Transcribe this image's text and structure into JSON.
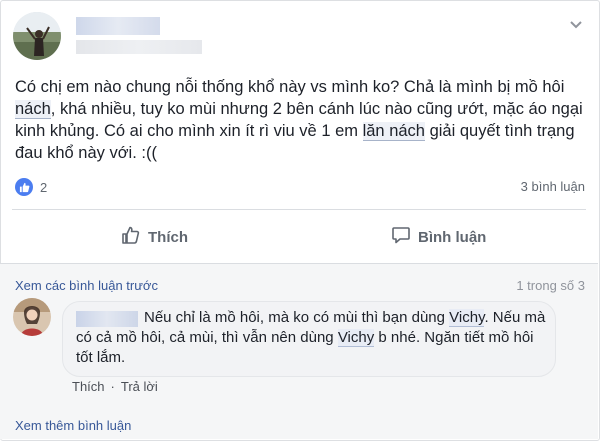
{
  "post": {
    "text_parts": [
      "Có chị em nào chung nỗi thống khổ này vs mình ko? Chả là mình bị mồ hôi ",
      "nách",
      ", khá nhiều, tuy ko mùi nhưng 2 bên cánh lúc nào cũng ướt, mặc áo ngại kinh khủng. Có ai cho mình xin ít rì viu về 1 em ",
      "lăn nách",
      " giải quyết tình trạng đau khổ này với. :(("
    ],
    "like_count": "2",
    "comment_count": "3 bình luận"
  },
  "actions": {
    "like_label": "Thích",
    "comment_label": "Bình luận"
  },
  "comments_section": {
    "view_previous": "Xem các bình luận trước",
    "page_count": "1 trong số 3",
    "comment": {
      "text_parts": [
        "Nếu chỉ là mồ hôi, mà ko có mùi thì bạn dùng ",
        "Vichy",
        ". Nếu mà có cả mồ hôi, cả mùi, thì vẫn nên dùng ",
        "Vichy",
        " b nhé. Ngăn tiết mồ hôi tốt lắm."
      ],
      "like_label": "Thích",
      "separator": "·",
      "reply_label": "Trả lời"
    },
    "view_more": "Xem thêm bình luận"
  },
  "colors": {
    "link": "#385898",
    "like_badge": "#4b7df0",
    "secondary_text": "#606770"
  }
}
